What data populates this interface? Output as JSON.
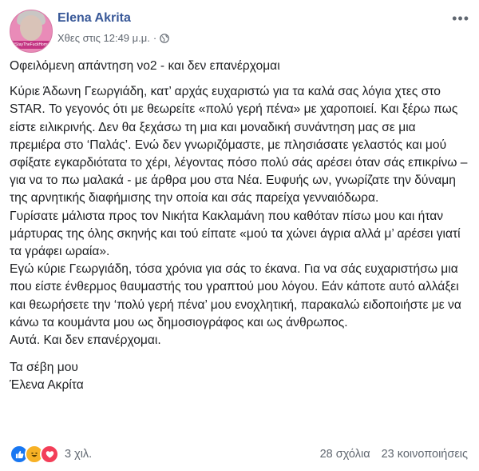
{
  "post": {
    "author": "Elena Akrita",
    "timestamp": "Χθες στις 12:49 μ.μ.",
    "separator": "·",
    "avatar_banner": "#StayTheFuckHome",
    "title": "Οφειλόμενη απάντηση νο2 - και δεν επανέρχομαι",
    "body": [
      "Κύριε Άδωνη Γεωργιάδη, κατ’ αρχάς ευχαριστώ για τα καλά σας λόγια χτες στο STAR. Το γεγονός ότι με θεωρείτε «πολύ γερή πένα» με χαροποιεί. Και ξέρω πως είστε ειλικρινής. Δεν θα ξεχάσω τη μια και μοναδική συνάντηση μας σε μια πρεμιέρα στο ‘Παλάς’. Ενώ δεν γνωριζόμαστε, με πλησιάσατε γελαστός και μού σφίξατε εγκαρδιότατα το χέρι, λέγοντας πόσο πολύ σάς αρέσει όταν σάς επικρίνω – για να το πω μαλακά - με άρθρα μου στα Νέα. Ευφυής ων, γνωρίζατε την δύναμη της αρνητικής διαφήμισης την οποία και σάς παρείχα γενναιόδωρα.",
      "Γυρίσατε μάλιστα προς τον Νικήτα Κακλαμάνη που καθόταν πίσω μου και ήταν μάρτυρας της όλης σκηνής και τού είπατε «μού τα χώνει άγρια αλλά μ’ αρέσει γιατί τα γράφει ωραία».",
      "Εγώ κύριε Γεωργιάδη, τόσα χρόνια για σάς το έκανα. Για να σάς ευχαριστήσω μια που είστε ένθερμος θαυμαστής του γραπτού μου λόγου. Εάν κάποτε αυτό αλλάξει και θεωρήσετε την ‘πολύ γερή πένα’ μου ενοχλητική, παρακαλώ ειδοποιήστε με να κάνω τα κουμάντα μου ως δημοσιογράφος και ως άνθρωπος.",
      "Αυτά. Και δεν επανέρχομαι."
    ],
    "signoff": [
      "Τα σέβη μου",
      "Έλενα Ακρίτα"
    ]
  },
  "stats": {
    "reactions_count": "3 χιλ.",
    "comments": "28 σχόλια",
    "shares": "23 κοινοποιήσεις"
  },
  "icons": {
    "reactions": [
      "like-icon",
      "haha-icon",
      "love-icon"
    ],
    "privacy": "globe-icon",
    "menu": "more-options-icon"
  },
  "colors": {
    "author_link": "#385898",
    "meta_text": "#606770",
    "like": "#1877f2",
    "haha": "#f7b125",
    "love": "#f33e58"
  }
}
